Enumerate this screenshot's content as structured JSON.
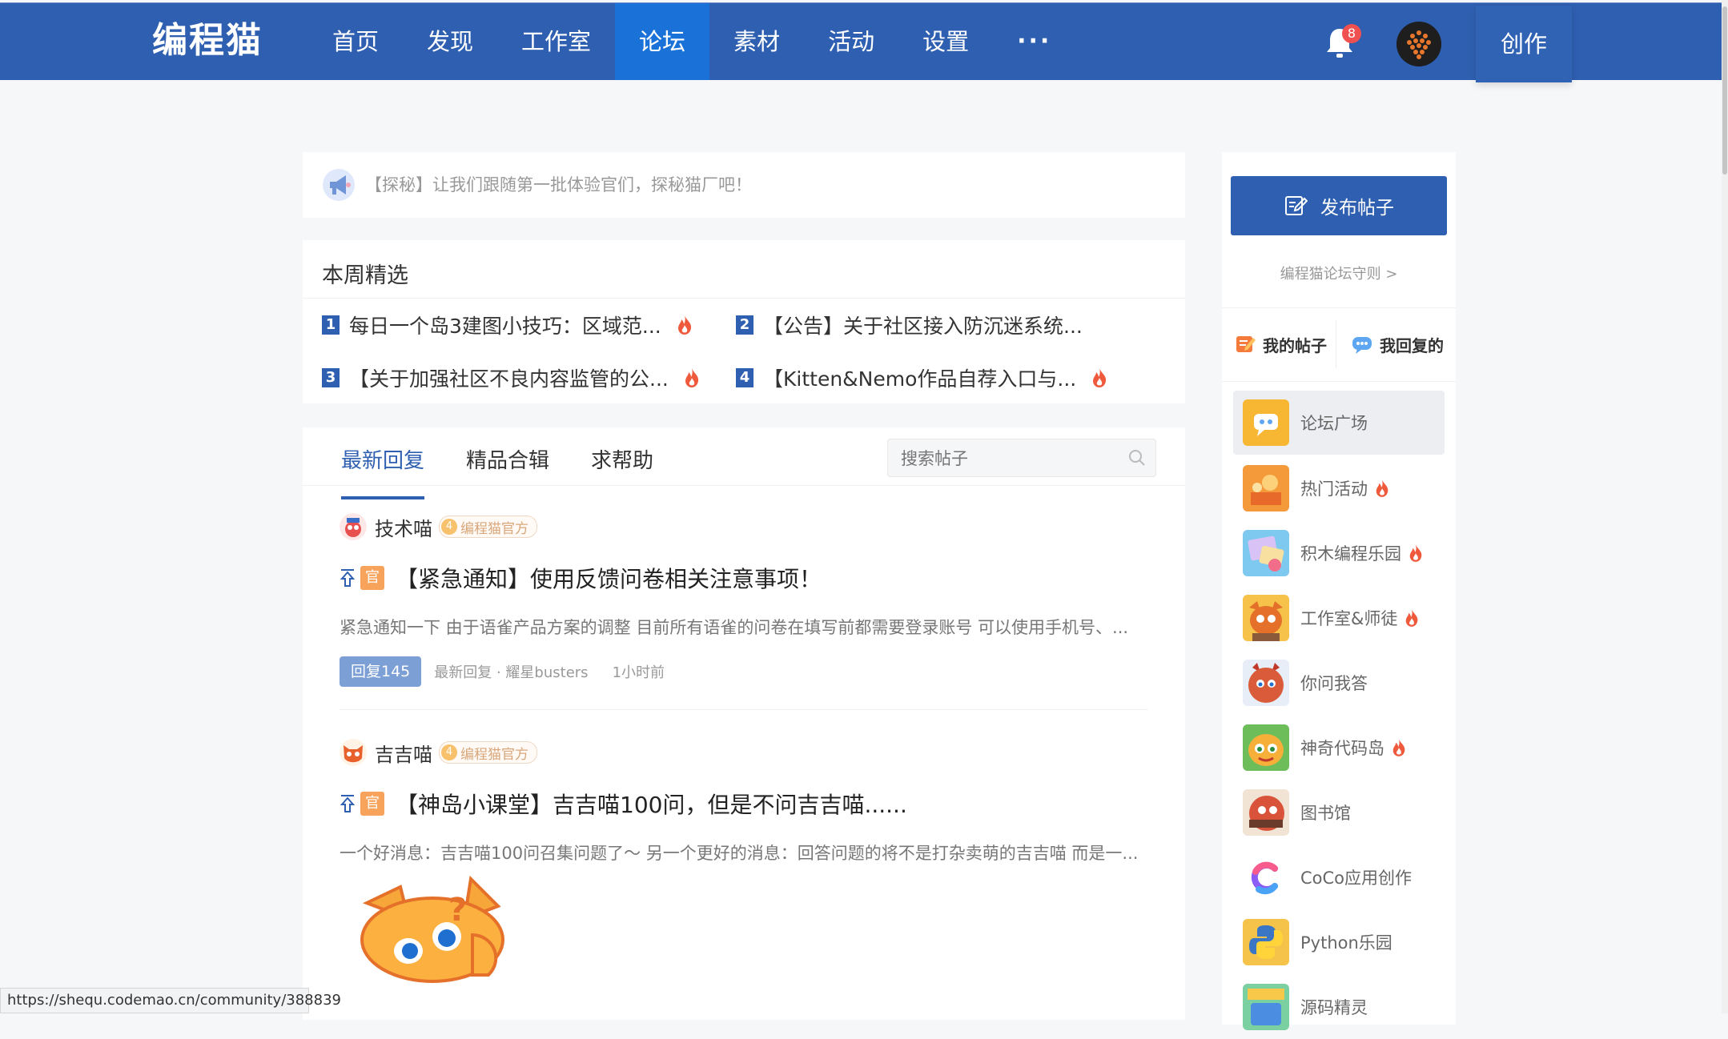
{
  "header": {
    "logo": "编程猫",
    "nav": [
      "首页",
      "发现",
      "工作室",
      "论坛",
      "素材",
      "活动",
      "设置"
    ],
    "active_nav": "论坛",
    "notification_count": "8",
    "create_label": "创作"
  },
  "announcement": {
    "text": "【探秘】让我们跟随第一批体验官们，探秘猫厂吧！"
  },
  "weekly": {
    "title": "本周精选",
    "items": [
      {
        "rank": "1",
        "title": "每日一个岛3建图小技巧：区域范..."
      },
      {
        "rank": "2",
        "title": "【公告】关于社区接入防沉迷系统..."
      },
      {
        "rank": "3",
        "title": "【关于加强社区不良内容监管的公..."
      },
      {
        "rank": "4",
        "title": "【Kitten&Nemo作品自荐入口与..."
      }
    ]
  },
  "feed": {
    "tabs": [
      "最新回复",
      "精品合辑",
      "求帮助"
    ],
    "active_tab": "最新回复",
    "search_placeholder": "搜索帖子",
    "posts": [
      {
        "author": "技术喵",
        "level": "4",
        "badge": "编程猫官方",
        "tag": "官",
        "title": "【紧急通知】使用反馈问卷相关注意事项！",
        "excerpt": "紧急通知一下 由于语雀产品方案的调整     目前所有语雀的问卷在填写前都需要登录账号 可以使用手机号、...",
        "reply_count": "回复145",
        "latest_reply": "最新回复 · 耀星busters",
        "time": "1小时前"
      },
      {
        "author": "吉吉喵",
        "level": "4",
        "badge": "编程猫官方",
        "tag": "官",
        "title": "【神岛小课堂】吉吉喵100问，但是不问吉吉喵......",
        "excerpt": "一个好消息：吉吉喵100问召集问题了～ 另一个更好的消息：回答问题的将不是打杂卖萌的吉吉喵 而是一..."
      }
    ]
  },
  "sidebar": {
    "publish_label": "发布帖子",
    "rules_link": "编程猫论坛守则 >",
    "my_posts": "我的帖子",
    "my_replies": "我回复的",
    "boards": [
      {
        "label": "论坛广场",
        "hot": false
      },
      {
        "label": "热门活动",
        "hot": true
      },
      {
        "label": "积木编程乐园",
        "hot": true
      },
      {
        "label": "工作室&师徒",
        "hot": true
      },
      {
        "label": "你问我答",
        "hot": false
      },
      {
        "label": "神奇代码岛",
        "hot": true
      },
      {
        "label": "图书馆",
        "hot": false
      },
      {
        "label": "CoCo应用创作",
        "hot": false
      },
      {
        "label": "Python乐园",
        "hot": false
      },
      {
        "label": "源码精灵",
        "hot": false
      }
    ]
  },
  "status_url": "https://shequ.codemao.cn/community/388839",
  "colors": {
    "brand_blue": "#2f5fb0",
    "active_nav": "#1a72d9",
    "hot": "#f05a3c",
    "official_tag": "#f7a35c"
  }
}
